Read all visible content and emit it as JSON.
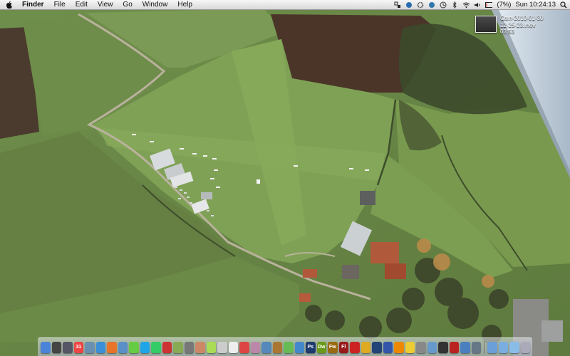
{
  "menubar": {
    "app_name": "Finder",
    "items": [
      "File",
      "Edit",
      "View",
      "Go",
      "Window",
      "Help"
    ],
    "battery": "(7%)",
    "clock": "Sun 10:24:13"
  },
  "desktop_file": {
    "name": "Cam-2010-01-30 12-25-23.mov",
    "duration": "03:53"
  },
  "dock": {
    "icons": [
      {
        "name": "finder",
        "color": "#4a84d8",
        "glyph": ""
      },
      {
        "name": "dashboard",
        "color": "#444",
        "glyph": ""
      },
      {
        "name": "expose",
        "color": "#556",
        "glyph": ""
      },
      {
        "name": "calendar",
        "color": "#e44",
        "glyph": "31"
      },
      {
        "name": "preview",
        "color": "#6a8fb0",
        "glyph": ""
      },
      {
        "name": "safari",
        "color": "#3a8fd8",
        "glyph": ""
      },
      {
        "name": "firefox",
        "color": "#e8742a",
        "glyph": ""
      },
      {
        "name": "mail",
        "color": "#5b8fc8",
        "glyph": ""
      },
      {
        "name": "spotify",
        "color": "#6c4",
        "glyph": ""
      },
      {
        "name": "skype",
        "color": "#1ea5e8",
        "glyph": ""
      },
      {
        "name": "ical",
        "color": "#3c6",
        "glyph": ""
      },
      {
        "name": "photobooth",
        "color": "#c33",
        "glyph": ""
      },
      {
        "name": "vlc",
        "color": "#8a5",
        "glyph": ""
      },
      {
        "name": "scripts",
        "color": "#777",
        "glyph": ""
      },
      {
        "name": "guitar",
        "color": "#c86",
        "glyph": ""
      },
      {
        "name": "itunes",
        "color": "#ad5",
        "glyph": ""
      },
      {
        "name": "textedit",
        "color": "#ccc",
        "glyph": ""
      },
      {
        "name": "addressbook",
        "color": "#eee",
        "glyph": ""
      },
      {
        "name": "pdf",
        "color": "#d44",
        "glyph": ""
      },
      {
        "name": "mplayer",
        "color": "#b8a",
        "glyph": ""
      },
      {
        "name": "network",
        "color": "#58b",
        "glyph": ""
      },
      {
        "name": "books",
        "color": "#a73",
        "glyph": ""
      },
      {
        "name": "maps",
        "color": "#6b5",
        "glyph": ""
      },
      {
        "name": "messenger",
        "color": "#48c",
        "glyph": ""
      },
      {
        "name": "photoshop",
        "color": "#1d3a6e",
        "glyph": "Ps"
      },
      {
        "name": "dreamweaver",
        "color": "#6a9a1a",
        "glyph": "Dw"
      },
      {
        "name": "fireworks",
        "color": "#9a6a10",
        "glyph": "Fw"
      },
      {
        "name": "flash",
        "color": "#9a1a1a",
        "glyph": "Fl"
      },
      {
        "name": "acrobat",
        "color": "#c22",
        "glyph": ""
      },
      {
        "name": "radiation",
        "color": "#da2",
        "glyph": ""
      },
      {
        "name": "blue-globe",
        "color": "#247",
        "glyph": ""
      },
      {
        "name": "google-earth",
        "color": "#35a",
        "glyph": ""
      },
      {
        "name": "vlc-cone",
        "color": "#e80",
        "glyph": ""
      },
      {
        "name": "cyberduck",
        "color": "#ec3",
        "glyph": ""
      },
      {
        "name": "system-preferences",
        "color": "#888",
        "glyph": ""
      },
      {
        "name": "app-store",
        "color": "#69c",
        "glyph": ""
      },
      {
        "name": "activity-monitor",
        "color": "#333",
        "glyph": ""
      },
      {
        "name": "filezilla",
        "color": "#b22",
        "glyph": ""
      },
      {
        "name": "xcode",
        "color": "#4a7fc0",
        "glyph": ""
      },
      {
        "name": "calculator",
        "color": "#678",
        "glyph": ""
      },
      {
        "name": "applications-folder",
        "color": "#6a9fd8",
        "glyph": ""
      },
      {
        "name": "documents-folder",
        "color": "#7aaee0",
        "glyph": ""
      },
      {
        "name": "downloads-folder",
        "color": "#8abce8",
        "glyph": ""
      },
      {
        "name": "trash",
        "color": "#aab",
        "glyph": ""
      }
    ]
  }
}
